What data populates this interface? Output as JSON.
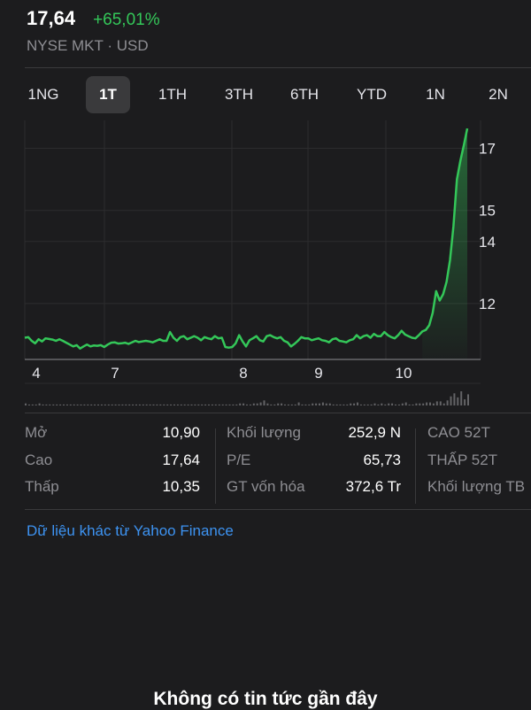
{
  "quote": {
    "price": "17,64",
    "change": "+65,01%",
    "exchange": "NYSE MKT · USD"
  },
  "tabs": [
    "1NG",
    "1T",
    "1TH",
    "3TH",
    "6TH",
    "YTD",
    "1N",
    "2N"
  ],
  "active_tab": "1T",
  "colors": {
    "background": "#1c1c1e",
    "accent_green": "#34c759",
    "link_blue": "#3d93f2",
    "muted_text": "#8e8e93"
  },
  "chart_data": {
    "type": "line",
    "x_tick_labels": [
      "4",
      "7",
      "8",
      "9",
      "10"
    ],
    "y_tick_labels": [
      "17",
      "15",
      "14",
      "12"
    ],
    "ylim": [
      10.2,
      17.9
    ],
    "grid": true,
    "series": [
      {
        "values": [
          10.9,
          10.92,
          10.8,
          10.72,
          10.85,
          10.78,
          10.88,
          10.86,
          10.84,
          10.8,
          10.85,
          10.8,
          10.74,
          10.68,
          10.62,
          10.66,
          10.55,
          10.62,
          10.68,
          10.62,
          10.65,
          10.64,
          10.66,
          10.6,
          10.68,
          10.74,
          10.75,
          10.71,
          10.72,
          10.74,
          10.7,
          10.75,
          10.8,
          10.76,
          10.78,
          10.8,
          10.78,
          10.75,
          10.8,
          10.85,
          10.8,
          10.8,
          11.08,
          10.9,
          10.8,
          10.92,
          10.95,
          10.85,
          10.9,
          10.95,
          10.9,
          10.82,
          10.92,
          10.88,
          10.85,
          10.95,
          10.88,
          10.9,
          10.6,
          10.58,
          10.6,
          10.72,
          10.98,
          10.78,
          10.62,
          10.82,
          10.88,
          10.95,
          10.82,
          10.78,
          10.95,
          10.98,
          10.92,
          10.88,
          10.92,
          10.8,
          10.75,
          10.62,
          10.7,
          10.8,
          10.92,
          10.88,
          10.88,
          10.82,
          10.85,
          10.88,
          10.82,
          10.8,
          10.75,
          10.85,
          10.88,
          10.8,
          10.78,
          10.75,
          10.82,
          10.85,
          10.98,
          10.88,
          10.95,
          10.98,
          10.9,
          11.02,
          10.95,
          10.95,
          11.08,
          10.98,
          10.92,
          10.88,
          10.98,
          11.12,
          11.0,
          10.95,
          10.9,
          10.88,
          10.98,
          11.1,
          11.15,
          11.3,
          11.7,
          12.4,
          12.1,
          12.3,
          12.7,
          13.4,
          14.5,
          16.0,
          16.6,
          17.1,
          17.64
        ]
      }
    ],
    "volume": [
      2,
      1,
      1,
      1,
      2,
      1,
      1,
      1,
      1,
      1,
      1,
      1,
      1,
      1,
      1,
      1,
      1,
      1,
      1,
      1,
      1,
      1,
      1,
      1,
      1,
      1,
      1,
      1,
      1,
      1,
      1,
      1,
      1,
      1,
      1,
      1,
      1,
      1,
      1,
      1,
      1,
      1,
      1,
      1,
      1,
      1,
      1,
      1,
      1,
      1,
      1,
      1,
      1,
      1,
      1,
      1,
      1,
      1,
      1,
      1,
      1,
      1,
      2,
      2,
      1,
      1,
      2,
      2,
      3,
      5,
      2,
      1,
      1,
      2,
      2,
      1,
      1,
      1,
      1,
      3,
      1,
      1,
      1,
      2,
      2,
      2,
      3,
      2,
      2,
      1,
      1,
      1,
      1,
      1,
      2,
      2,
      3,
      1,
      1,
      1,
      1,
      2,
      1,
      2,
      1,
      2,
      2,
      1,
      1,
      2,
      3,
      1,
      1,
      2,
      2,
      2,
      3,
      3,
      2,
      4,
      4,
      2,
      5,
      9,
      12,
      8,
      14,
      6,
      11
    ]
  },
  "stats": {
    "col1": [
      {
        "label": "Mở",
        "value": "10,90"
      },
      {
        "label": "Cao",
        "value": "17,64"
      },
      {
        "label": "Thấp",
        "value": "10,35"
      }
    ],
    "col2": [
      {
        "label": "Khối lượng",
        "value": "252,9 N"
      },
      {
        "label": "P/E",
        "value": "65,73"
      },
      {
        "label": "GT vốn hóa",
        "value": "372,6 Tr"
      }
    ],
    "col3": [
      {
        "label": "CAO 52T"
      },
      {
        "label": "THẤP 52T"
      },
      {
        "label": "Khối lượng TB"
      }
    ]
  },
  "yahoo_link": "Dữ liệu khác từ Yahoo Finance",
  "news_heading": "Không có tin tức gần đây"
}
